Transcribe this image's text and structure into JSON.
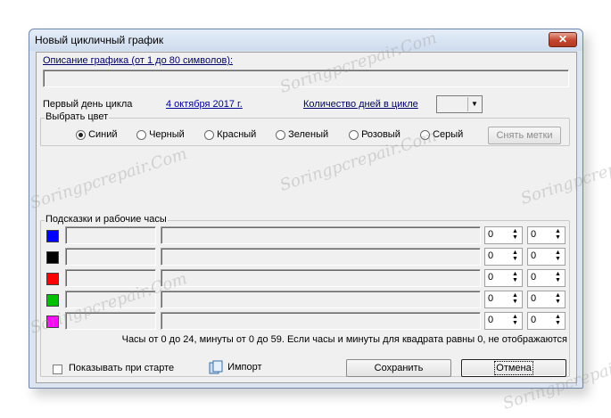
{
  "window": {
    "title": "Новый цикличный график",
    "close_label": "✕"
  },
  "description": {
    "label": "Описание графика (от 1 до 80 символов):",
    "value": ""
  },
  "cycle": {
    "first_day_label": "Первый день цикла",
    "first_day_value": "4 октября 2017 г.",
    "days_count_label": "Количество дней в цикле",
    "days_count_value": ""
  },
  "color_group": {
    "label": "Выбрать цвет",
    "options": [
      {
        "label": "Синий",
        "checked": true
      },
      {
        "label": "Черный",
        "checked": false
      },
      {
        "label": "Красный",
        "checked": false
      },
      {
        "label": "Зеленый",
        "checked": false
      },
      {
        "label": "Розовый",
        "checked": false
      },
      {
        "label": "Серый",
        "checked": false
      }
    ],
    "clear_button": "Снять метки"
  },
  "hints_group": {
    "label": "Подсказки и рабочие часы",
    "rows": [
      {
        "color": "#0000ff",
        "hours": "0",
        "minutes": "0"
      },
      {
        "color": "#000000",
        "hours": "0",
        "minutes": "0"
      },
      {
        "color": "#ff0000",
        "hours": "0",
        "minutes": "0"
      },
      {
        "color": "#00c000",
        "hours": "0",
        "minutes": "0"
      },
      {
        "color": "#ff00ff",
        "hours": "0",
        "minutes": "0"
      }
    ],
    "note": "Часы от 0 до 24, минуты от 0 до 59. Если часы и минуты для квадрата равны 0, не отображаются"
  },
  "footer": {
    "show_on_start_label": "Показывать при старте",
    "import_label": "Импорт",
    "save_button": "Сохранить",
    "cancel_button": "Отмена"
  },
  "watermark": "Soringpcrepair.Com"
}
